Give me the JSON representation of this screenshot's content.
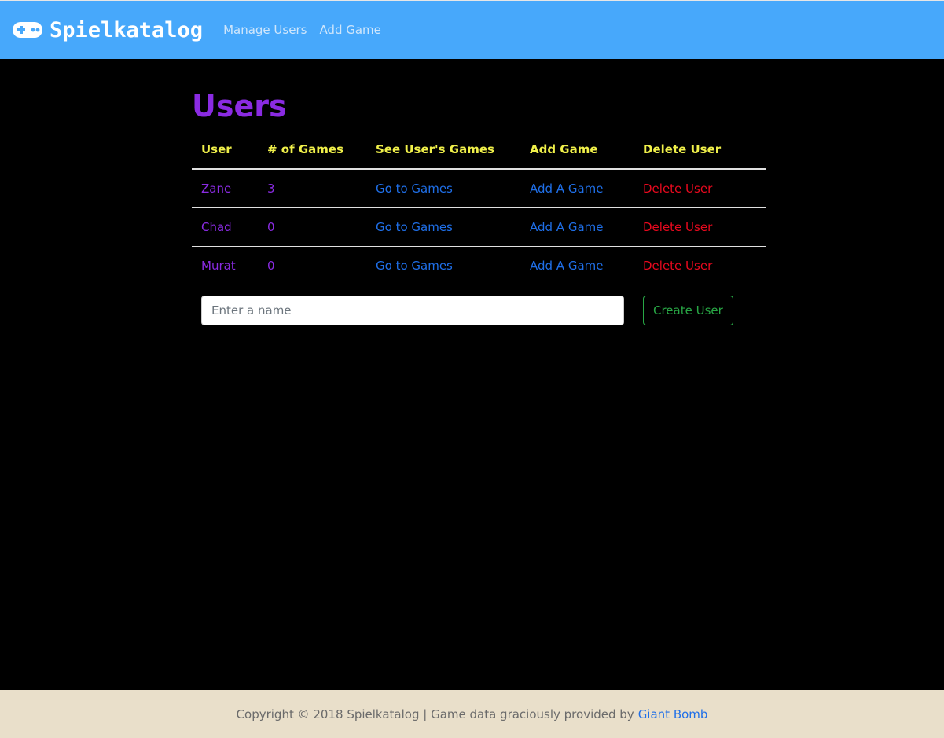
{
  "nav": {
    "brand": "Spielkatalog",
    "brand_icon": "gamepad-icon",
    "links": [
      "Manage Users",
      "Add Game"
    ]
  },
  "page": {
    "title": "Users"
  },
  "table": {
    "headers": [
      "User",
      "# of Games",
      "See User's Games",
      "Add Game",
      "Delete User"
    ],
    "rows": [
      {
        "user": "Zane",
        "count": "3",
        "go": "Go to Games",
        "add": "Add A Game",
        "delete": "Delete User"
      },
      {
        "user": "Chad",
        "count": "0",
        "go": "Go to Games",
        "add": "Add A Game",
        "delete": "Delete User"
      },
      {
        "user": "Murat",
        "count": "0",
        "go": "Go to Games",
        "add": "Add A Game",
        "delete": "Delete User"
      }
    ]
  },
  "form": {
    "placeholder": "Enter a name",
    "value": "",
    "button": "Create User"
  },
  "footer": {
    "text": "Copyright © 2018 Spielkatalog | Game data graciously provided by",
    "link": "Giant Bomb"
  },
  "colors": {
    "navbar": "#47a8fb",
    "background": "#000000",
    "title": "#8a2be2",
    "header_text": "#f0f04a",
    "link": "#1f6fe8",
    "delete": "#e8091e",
    "create": "#28a745",
    "footer": "#e9dfca"
  }
}
